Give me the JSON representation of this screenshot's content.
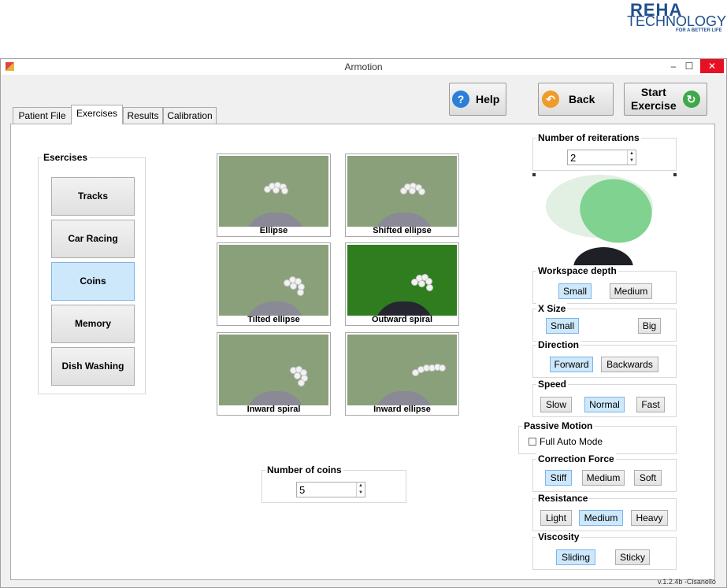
{
  "logo": {
    "reha": "REHA",
    "technology": "TECHNOLOGY",
    "tagline": "FOR A BETTER LIFE"
  },
  "window": {
    "title": "Armotion",
    "controls": {
      "minimize": "–",
      "maximize": "☐",
      "close": "✕"
    }
  },
  "tabs": [
    "Patient File",
    "Exercises",
    "Results",
    "Calibration"
  ],
  "active_tab": "Exercises",
  "header_buttons": {
    "help": {
      "label": "Help",
      "icon": "help-icon"
    },
    "back": {
      "label": "Back",
      "icon": "back-arrow-icon"
    },
    "start": {
      "label_line1": "Start",
      "label_line2": "Exercise",
      "icon": "refresh-icon"
    }
  },
  "exercises_group": {
    "title": "Esercises",
    "items": [
      "Tracks",
      "Car Racing",
      "Coins",
      "Memory",
      "Dish Washing"
    ],
    "selected": "Coins"
  },
  "thumbnails": [
    "Ellipse",
    "Shifted ellipse",
    "Tilted ellipse",
    "Outward spiral",
    "Inward spiral",
    "Inward ellipse"
  ],
  "coins": {
    "label": "Number of coins",
    "value": "5"
  },
  "reiterations": {
    "label": "Number of reiterations",
    "value": "2"
  },
  "workspace_depth": {
    "label": "Workspace depth",
    "options": [
      "Small",
      "Medium"
    ],
    "selected": "Small"
  },
  "x_size": {
    "label": "X Size",
    "options": [
      "Small",
      "Big"
    ],
    "selected": "Small"
  },
  "direction": {
    "label": "Direction",
    "options": [
      "Forward",
      "Backwards"
    ],
    "selected": "Forward"
  },
  "speed": {
    "label": "Speed",
    "options": [
      "Slow",
      "Normal",
      "Fast"
    ],
    "selected": "Normal"
  },
  "passive_motion": {
    "label": "Passive Motion",
    "checkbox_label": "Full Auto Mode",
    "checked": false
  },
  "correction_force": {
    "label": "Correction Force",
    "options": [
      "Stiff",
      "Medium",
      "Soft"
    ],
    "selected": "Stiff"
  },
  "resistance": {
    "label": "Resistance",
    "options": [
      "Light",
      "Medium",
      "Heavy"
    ],
    "selected": "Medium"
  },
  "viscosity": {
    "label": "Viscosity",
    "options": [
      "Sliding",
      "Sticky"
    ],
    "selected": "Sliding"
  },
  "version": "v.1.2.4b -Cisanello",
  "colors": {
    "accent_selected": "#cde8fb",
    "workspace_green": "#7fd28f",
    "field_green": "#8aa07a"
  }
}
